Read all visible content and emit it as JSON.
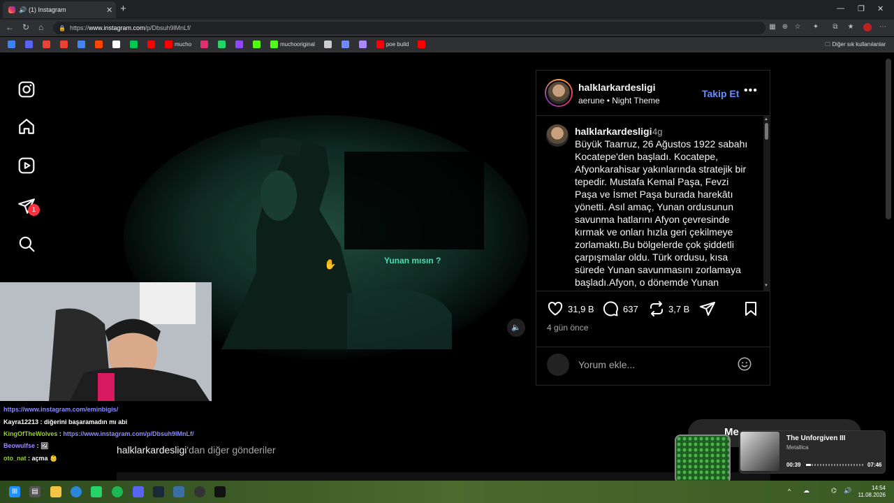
{
  "browser": {
    "tab_title": "(1) Instagram",
    "new_tab": "+",
    "url_prefix": "https://",
    "url_host": "www.instagram.com",
    "url_path": "/p/Dbsuh9lMnLf/",
    "bookmarks": [
      {
        "label": "",
        "color": "#3b82f6"
      },
      {
        "label": "",
        "color": "#5865f2"
      },
      {
        "label": "",
        "color": "#ea4335"
      },
      {
        "label": "",
        "color": "#ea4335"
      },
      {
        "label": "",
        "color": "#4285f4"
      },
      {
        "label": "",
        "color": "#ff4500"
      },
      {
        "label": "",
        "color": "#ffffff"
      },
      {
        "label": "",
        "color": "#00c853"
      },
      {
        "label": "",
        "color": "#ff0000"
      },
      {
        "label": "mucho",
        "color": "#ff0000"
      },
      {
        "label": "",
        "color": "#e1306c"
      },
      {
        "label": "",
        "color": "#25d366"
      },
      {
        "label": "",
        "color": "#9146ff"
      },
      {
        "label": "",
        "color": "#53fc18"
      },
      {
        "label": "muchooriginal",
        "color": "#53fc18"
      },
      {
        "label": "",
        "color": "#cccccc"
      },
      {
        "label": "",
        "color": "#6b8cff"
      },
      {
        "label": "",
        "color": "#a78bfa"
      },
      {
        "label": "poe build",
        "color": "#ff0000"
      },
      {
        "label": "",
        "color": "#ff0000"
      }
    ],
    "other_bookmarks": "Diğer sık kullanılanlar"
  },
  "sidebar": {
    "notification_count": "1"
  },
  "post": {
    "username": "halklarkardesligi",
    "audio": "aerune • Night Theme",
    "follow_label": "Takip Et",
    "more": "•••",
    "video_overlay_text": "Yunan mısın ?",
    "caption_user": "halklarkardesligi",
    "caption_time": "4g",
    "caption_text": "Büyük Taarruz, 26 Ağustos 1922 sabahı Kocatepe'den başladı. Kocatepe, Afyonkarahisar yakınlarında stratejik bir tepedir. Mustafa Kemal Paşa, Fevzi Paşa ve İsmet Paşa burada harekâtı yönetti. Asıl amaç, Yunan ordusunun savunma hatlarını Afyon çevresinde kırmak ve onları hızla geri çekilmeye zorlamaktı.Bu bölgelerde çok şiddetli çarpışmalar oldu. Türk ordusu, kısa sürede Yunan savunmasını zorlamaya başladı.Afyon, o dönemde Yunan ordusunun",
    "likes": "31,9 B",
    "comments": "637",
    "reposts": "3,7 B",
    "posted_ago": "4 gün önce",
    "comment_placeholder": "Yorum ekle...",
    "more_posts_user": "halklarkardesligi",
    "more_posts_suffix": "'dan diğer gönderiler"
  },
  "chat": [
    {
      "user": "",
      "text": "https://www.instagram.com/eminbigis/",
      "link": true
    },
    {
      "user": "Kayra12213",
      "text": "diğerini başaramadın mı abi",
      "link": false
    },
    {
      "user": "KingOfTheWolves",
      "text": "https://www.instagram.com/p/Dbsuh9lMnLf/",
      "link": true
    },
    {
      "user": "Beowulfse",
      "text": "",
      "link": false
    },
    {
      "user": "oto_nat",
      "text": "açma",
      "link": false
    }
  ],
  "player": {
    "song": "The Unforgiven III",
    "artist": "Metallica",
    "current": "00:39",
    "total": "07:46",
    "progress": 0.084
  },
  "messages_pill": "Me",
  "clock": {
    "time": "14:54",
    "date": "11.08.2026"
  }
}
